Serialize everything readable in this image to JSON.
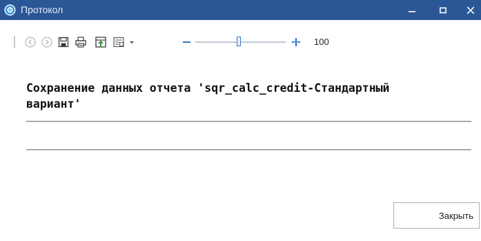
{
  "window": {
    "title": "Протокол",
    "accent_color": "#2b5797",
    "controls": [
      "minimize-icon",
      "maximize-icon",
      "close-icon"
    ]
  },
  "toolbar": {
    "icons": [
      "back-icon",
      "forward-icon",
      "save-icon",
      "print-icon",
      "export-icon",
      "page-setup-icon",
      "dropdown-arrow-icon",
      "zoom-out-icon",
      "zoom-in-icon"
    ],
    "zoom_value": "100"
  },
  "report": {
    "title": "Сохранение данных отчета 'sqr_calc_credit-Стандартный вариант'"
  },
  "footer": {
    "close_label": "Закрыть"
  }
}
